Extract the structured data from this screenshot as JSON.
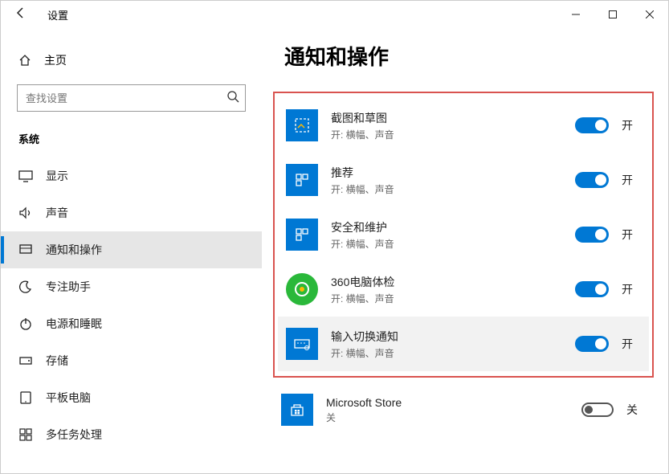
{
  "titlebar": {
    "title": "设置"
  },
  "sidebar": {
    "home": "主页",
    "search_placeholder": "查找设置",
    "section": "系统",
    "items": [
      {
        "label": "显示"
      },
      {
        "label": "声音"
      },
      {
        "label": "通知和操作"
      },
      {
        "label": "专注助手"
      },
      {
        "label": "电源和睡眠"
      },
      {
        "label": "存储"
      },
      {
        "label": "平板电脑"
      },
      {
        "label": "多任务处理"
      }
    ]
  },
  "content": {
    "heading": "通知和操作",
    "apps": [
      {
        "name": "截图和草图",
        "sub": "开: 横幅、声音",
        "on": true,
        "state": "开"
      },
      {
        "name": "推荐",
        "sub": "开: 横幅、声音",
        "on": true,
        "state": "开"
      },
      {
        "name": "安全和维护",
        "sub": "开: 横幅、声音",
        "on": true,
        "state": "开"
      },
      {
        "name": "360电脑体检",
        "sub": "开: 横幅、声音",
        "on": true,
        "state": "开"
      },
      {
        "name": "输入切换通知",
        "sub": "开: 横幅、声音",
        "on": true,
        "state": "开"
      },
      {
        "name": "Microsoft Store",
        "sub": "关",
        "on": false,
        "state": "关"
      }
    ]
  }
}
